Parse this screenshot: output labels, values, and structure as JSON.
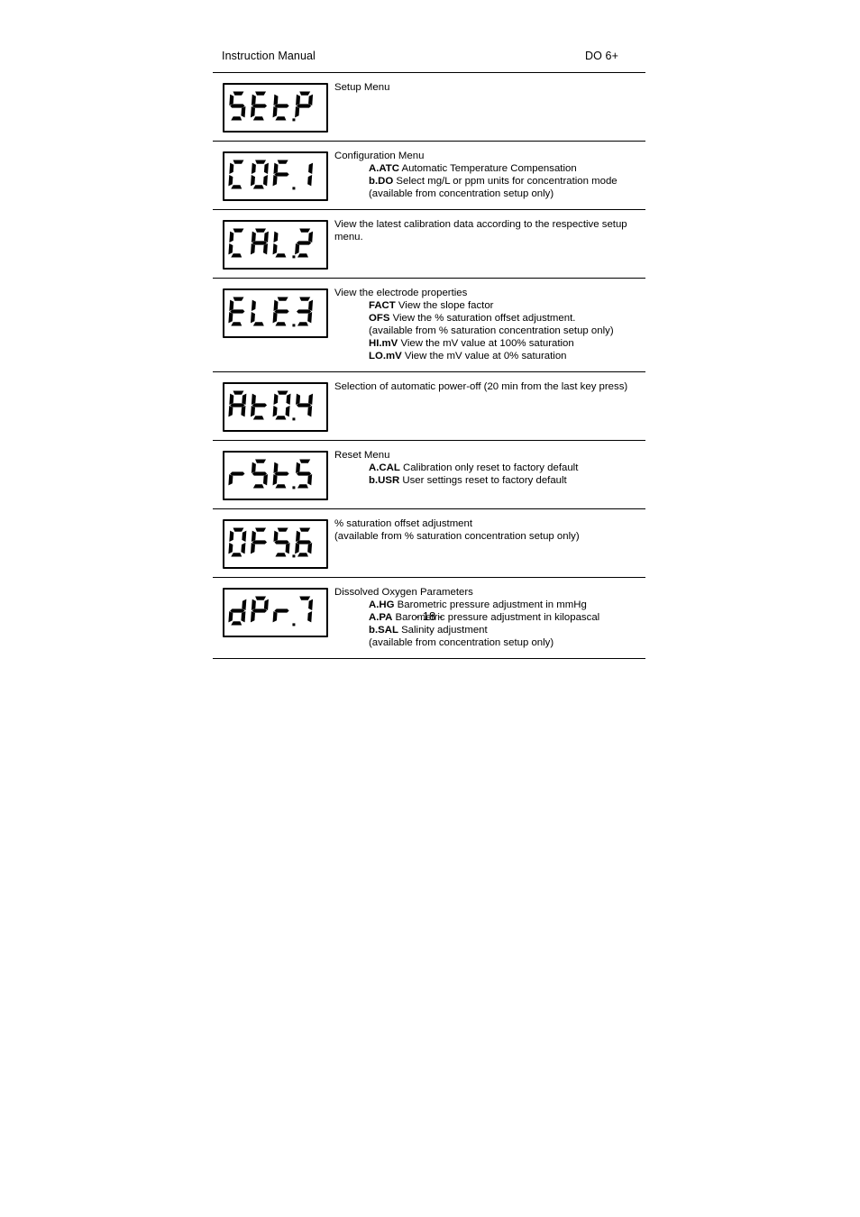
{
  "header": {
    "left": "Instruction Manual",
    "right": "DO 6+"
  },
  "rows": [
    {
      "display": "SEt.P",
      "segments": "SEt.P",
      "lines": [
        {
          "text": "Setup Menu",
          "indent": false,
          "bold": ""
        }
      ]
    },
    {
      "display": "COF.1",
      "segments": "COF.1",
      "lines": [
        {
          "text": "Configuration Menu",
          "indent": false,
          "bold": ""
        },
        {
          "text": "Automatic Temperature Compensation",
          "indent": true,
          "bold": "A.ATC"
        },
        {
          "text": "Select mg/L or ppm units for concentration mode",
          "indent": true,
          "bold": "b.DO"
        },
        {
          "text": "(available from concentration setup only)",
          "indent": true,
          "bold": ""
        }
      ]
    },
    {
      "display": "CAL.2",
      "segments": "CAL.2",
      "lines": [
        {
          "text": "View the latest calibration data according to the respective setup",
          "indent": false,
          "bold": ""
        },
        {
          "text": "menu.",
          "indent": false,
          "bold": ""
        }
      ]
    },
    {
      "display": "ELE.3",
      "segments": "ELE.3",
      "lines": [
        {
          "text": "View the electrode properties",
          "indent": false,
          "bold": ""
        },
        {
          "text": "View the slope factor",
          "indent": true,
          "bold": "FACT"
        },
        {
          "text": "View the % saturation offset adjustment.",
          "indent": true,
          "bold": "OFS"
        },
        {
          "text": "(available from % saturation concentration setup only)",
          "indent": true,
          "bold": ""
        },
        {
          "text": "View the mV value at 100% saturation",
          "indent": true,
          "bold": "HI.mV"
        },
        {
          "text": "View the mV value at 0% saturation",
          "indent": true,
          "bold": "LO.mV"
        }
      ]
    },
    {
      "display": "At0.4",
      "segments": "At0.4",
      "lines": [
        {
          "text": "Selection of automatic power-off (20 min from the last key press)",
          "indent": false,
          "bold": ""
        }
      ]
    },
    {
      "display": "rSt.5",
      "segments": "rSt.5",
      "lines": [
        {
          "text": "Reset Menu",
          "indent": false,
          "bold": ""
        },
        {
          "text": "Calibration only reset to factory default",
          "indent": true,
          "bold": "A.CAL"
        },
        {
          "text": "User settings reset to factory default",
          "indent": true,
          "bold": "b.USR"
        }
      ]
    },
    {
      "display": "OFS.6",
      "segments": "OFS.6",
      "lines": [
        {
          "text": "% saturation offset adjustment",
          "indent": false,
          "bold": ""
        },
        {
          "text": "(available from % saturation concentration setup only)",
          "indent": false,
          "bold": ""
        }
      ]
    },
    {
      "display": "dPr.7",
      "segments": "dPr.7",
      "lines": [
        {
          "text": "Dissolved Oxygen Parameters",
          "indent": false,
          "bold": ""
        },
        {
          "text": "Barometric pressure adjustment in mmHg",
          "indent": true,
          "bold": "A.HG"
        },
        {
          "text": "Barometric pressure adjustment in kilopascal",
          "indent": true,
          "bold": "A.PA"
        },
        {
          "text": "Salinity adjustment",
          "indent": true,
          "bold": "b.SAL"
        },
        {
          "text": "(available from concentration setup only)",
          "indent": true,
          "bold": ""
        }
      ]
    }
  ],
  "footer": {
    "page_number": "- 18 -"
  },
  "colors": {
    "ink": "#000000",
    "paper": "#ffffff"
  }
}
